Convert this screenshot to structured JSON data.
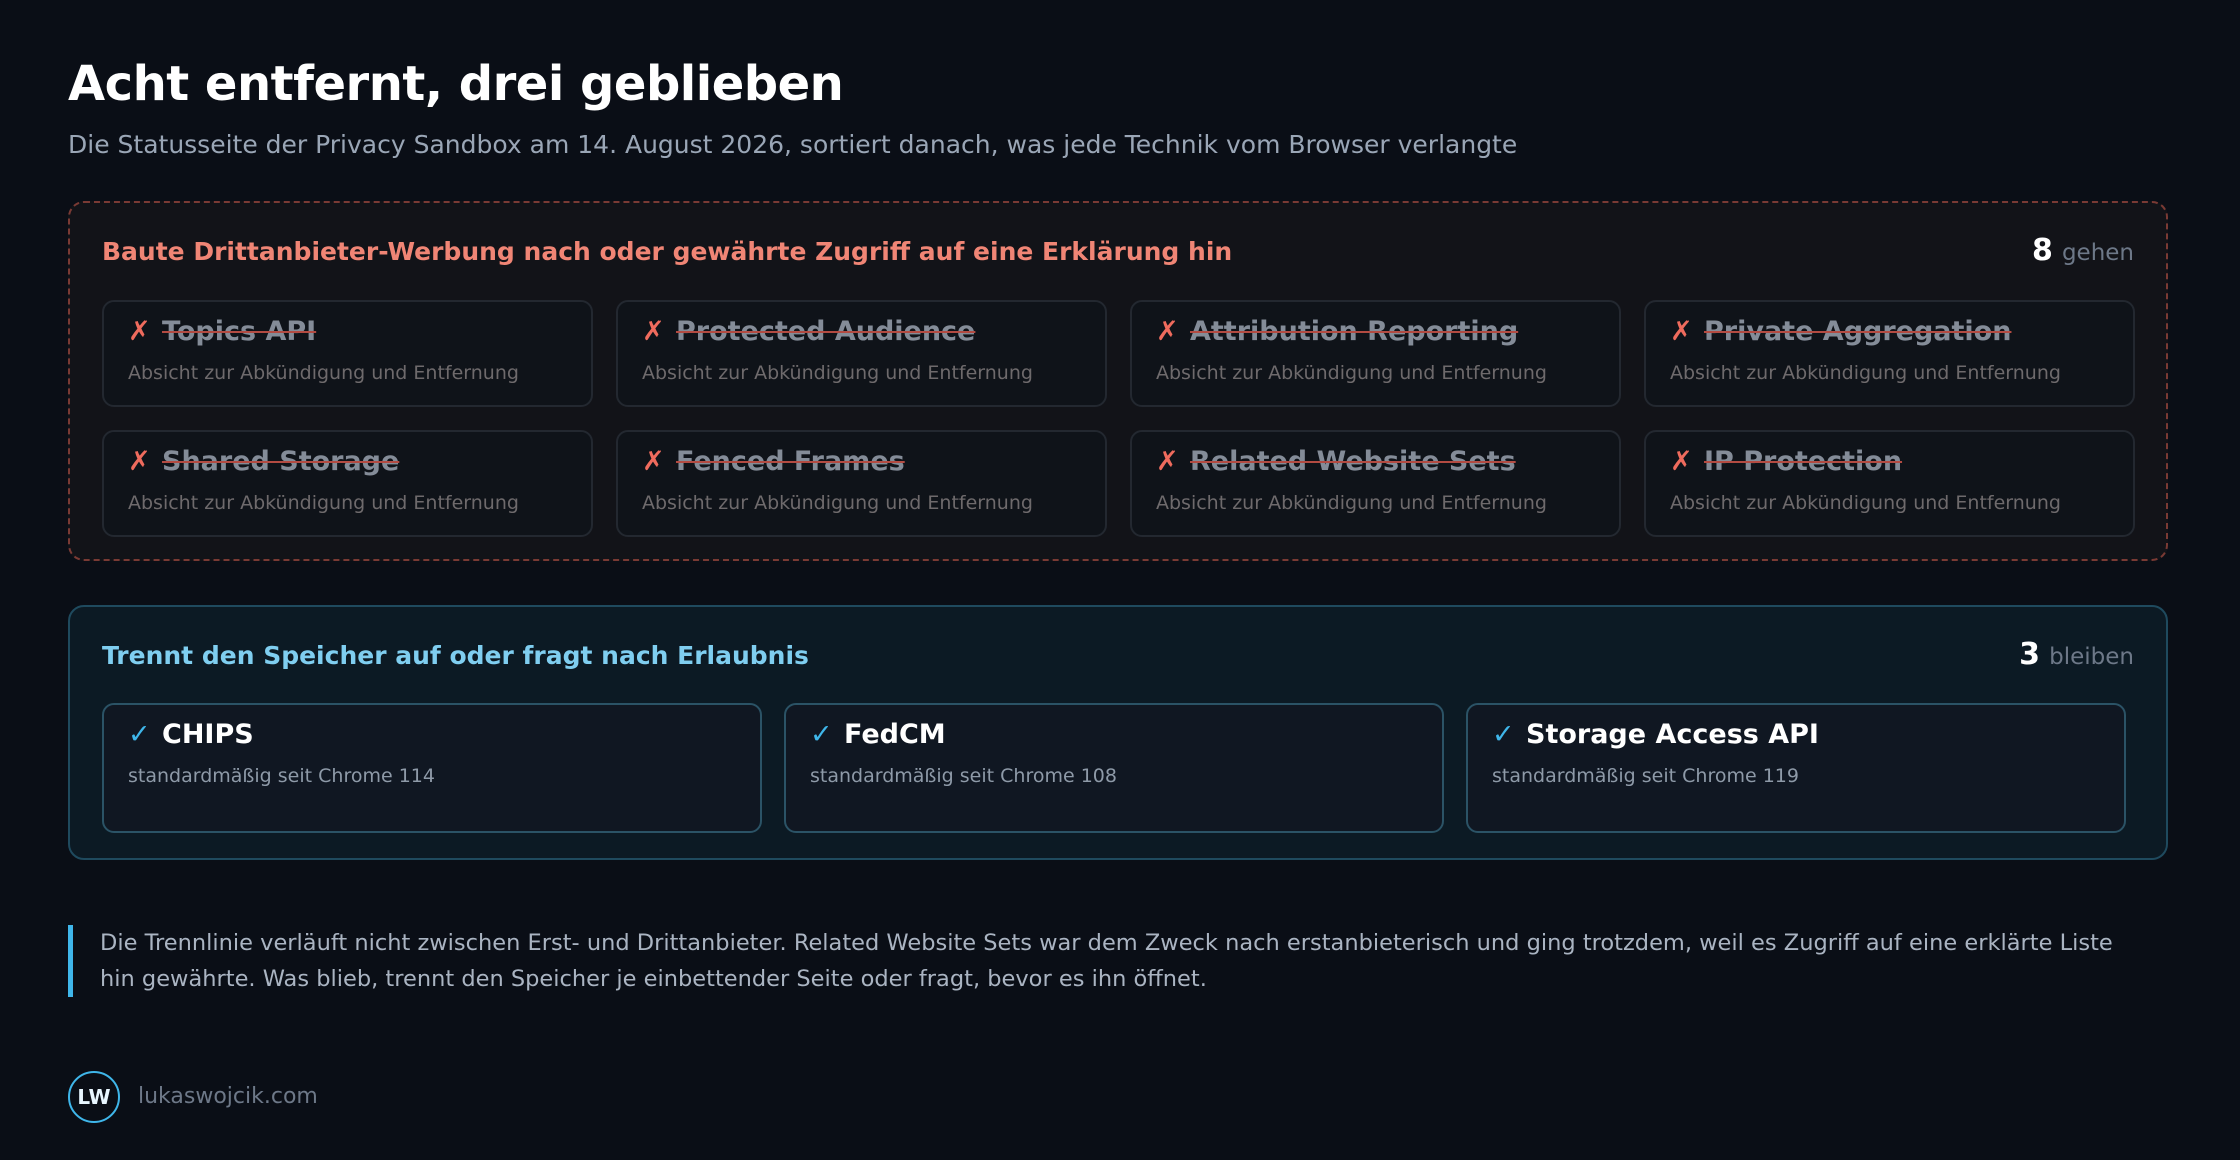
{
  "header": {
    "title": "Acht entfernt, drei geblieben",
    "subtitle": "Die Statusseite der Privacy Sandbox am 14. August 2026, sortiert danach, was jede Technik vom Browser verlangte"
  },
  "removed": {
    "title": "Baute Drittanbieter-Werbung nach oder gewährte Zugriff auf eine Erklärung hin",
    "count": "8",
    "count_label": "gehen",
    "mark": "✗",
    "items": [
      {
        "name": "Topics API",
        "status": "Absicht zur Abkündigung und Entfernung"
      },
      {
        "name": "Protected Audience",
        "status": "Absicht zur Abkündigung und Entfernung"
      },
      {
        "name": "Attribution Reporting",
        "status": "Absicht zur Abkündigung und Entfernung"
      },
      {
        "name": "Private Aggregation",
        "status": "Absicht zur Abkündigung und Entfernung"
      },
      {
        "name": "Shared Storage",
        "status": "Absicht zur Abkündigung und Entfernung"
      },
      {
        "name": "Fenced Frames",
        "status": "Absicht zur Abkündigung und Entfernung"
      },
      {
        "name": "Related Website Sets",
        "status": "Absicht zur Abkündigung und Entfernung"
      },
      {
        "name": "IP Protection",
        "status": "Absicht zur Abkündigung und Entfernung"
      }
    ]
  },
  "kept": {
    "title": "Trennt den Speicher auf oder fragt nach Erlaubnis",
    "count": "3",
    "count_label": "bleiben",
    "mark": "✓",
    "items": [
      {
        "name": "CHIPS",
        "status": "standardmäßig seit Chrome 114"
      },
      {
        "name": "FedCM",
        "status": "standardmäßig seit Chrome 108"
      },
      {
        "name": "Storage Access API",
        "status": "standardmäßig seit Chrome 119"
      }
    ]
  },
  "note": {
    "text": "Die Trennlinie verläuft nicht zwischen Erst- und Drittanbieter. Related Website Sets war dem Zweck nach erstanbieterisch und ging trotzdem, weil es Zugriff auf eine erklärte Liste hin gewährte. Was blieb, trennt den Speicher je einbettender Seite oder fragt, bevor es ihn öffnet."
  },
  "footer": {
    "logo": "LW",
    "site": "lukaswojcik.com"
  },
  "colors": {
    "background": "#0a0e16",
    "removed_accent": "#f08575",
    "kept_accent": "#3fb6ea"
  }
}
